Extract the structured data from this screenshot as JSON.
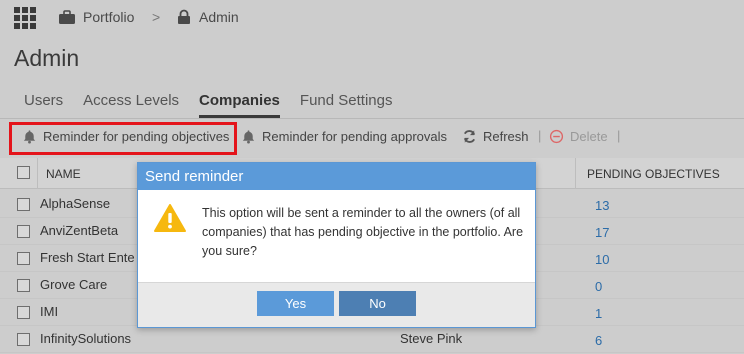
{
  "breadcrumb": {
    "root": "Portfolio",
    "separator": ">",
    "current": "Admin"
  },
  "page_title": "Admin",
  "tabs": [
    {
      "label": "Users",
      "active": false
    },
    {
      "label": "Access Levels",
      "active": false
    },
    {
      "label": "Companies",
      "active": true
    },
    {
      "label": "Fund Settings",
      "active": false
    }
  ],
  "toolbar": {
    "remind_objectives": "Reminder for pending objectives",
    "remind_approvals": "Reminder for pending approvals",
    "refresh": "Refresh",
    "delete": "Delete",
    "divider": "|"
  },
  "grid": {
    "columns": {
      "name": "NAME",
      "pending_objectives": "PENDING OBJECTIVES"
    },
    "rows": [
      {
        "name": "AlphaSense",
        "owner": "",
        "pending": "13"
      },
      {
        "name": "AnviZentBeta",
        "owner": "",
        "pending": "17"
      },
      {
        "name": "Fresh Start Ente",
        "owner": "",
        "pending": "10"
      },
      {
        "name": "Grove Care",
        "owner": "",
        "pending": "0"
      },
      {
        "name": "IMI",
        "owner": "",
        "pending": "1"
      },
      {
        "name": "InfinitySolutions",
        "owner": "Steve Pink",
        "pending": "6"
      }
    ]
  },
  "dialog": {
    "title": "Send reminder",
    "message": "This option will be sent a reminder to all the owners (of all companies) that has pending objective in the portfolio. Are you sure?",
    "yes": "Yes",
    "no": "No"
  },
  "colors": {
    "accent": "#5b9ad9",
    "highlight": "#e4141b",
    "link": "#2c6ca8"
  }
}
